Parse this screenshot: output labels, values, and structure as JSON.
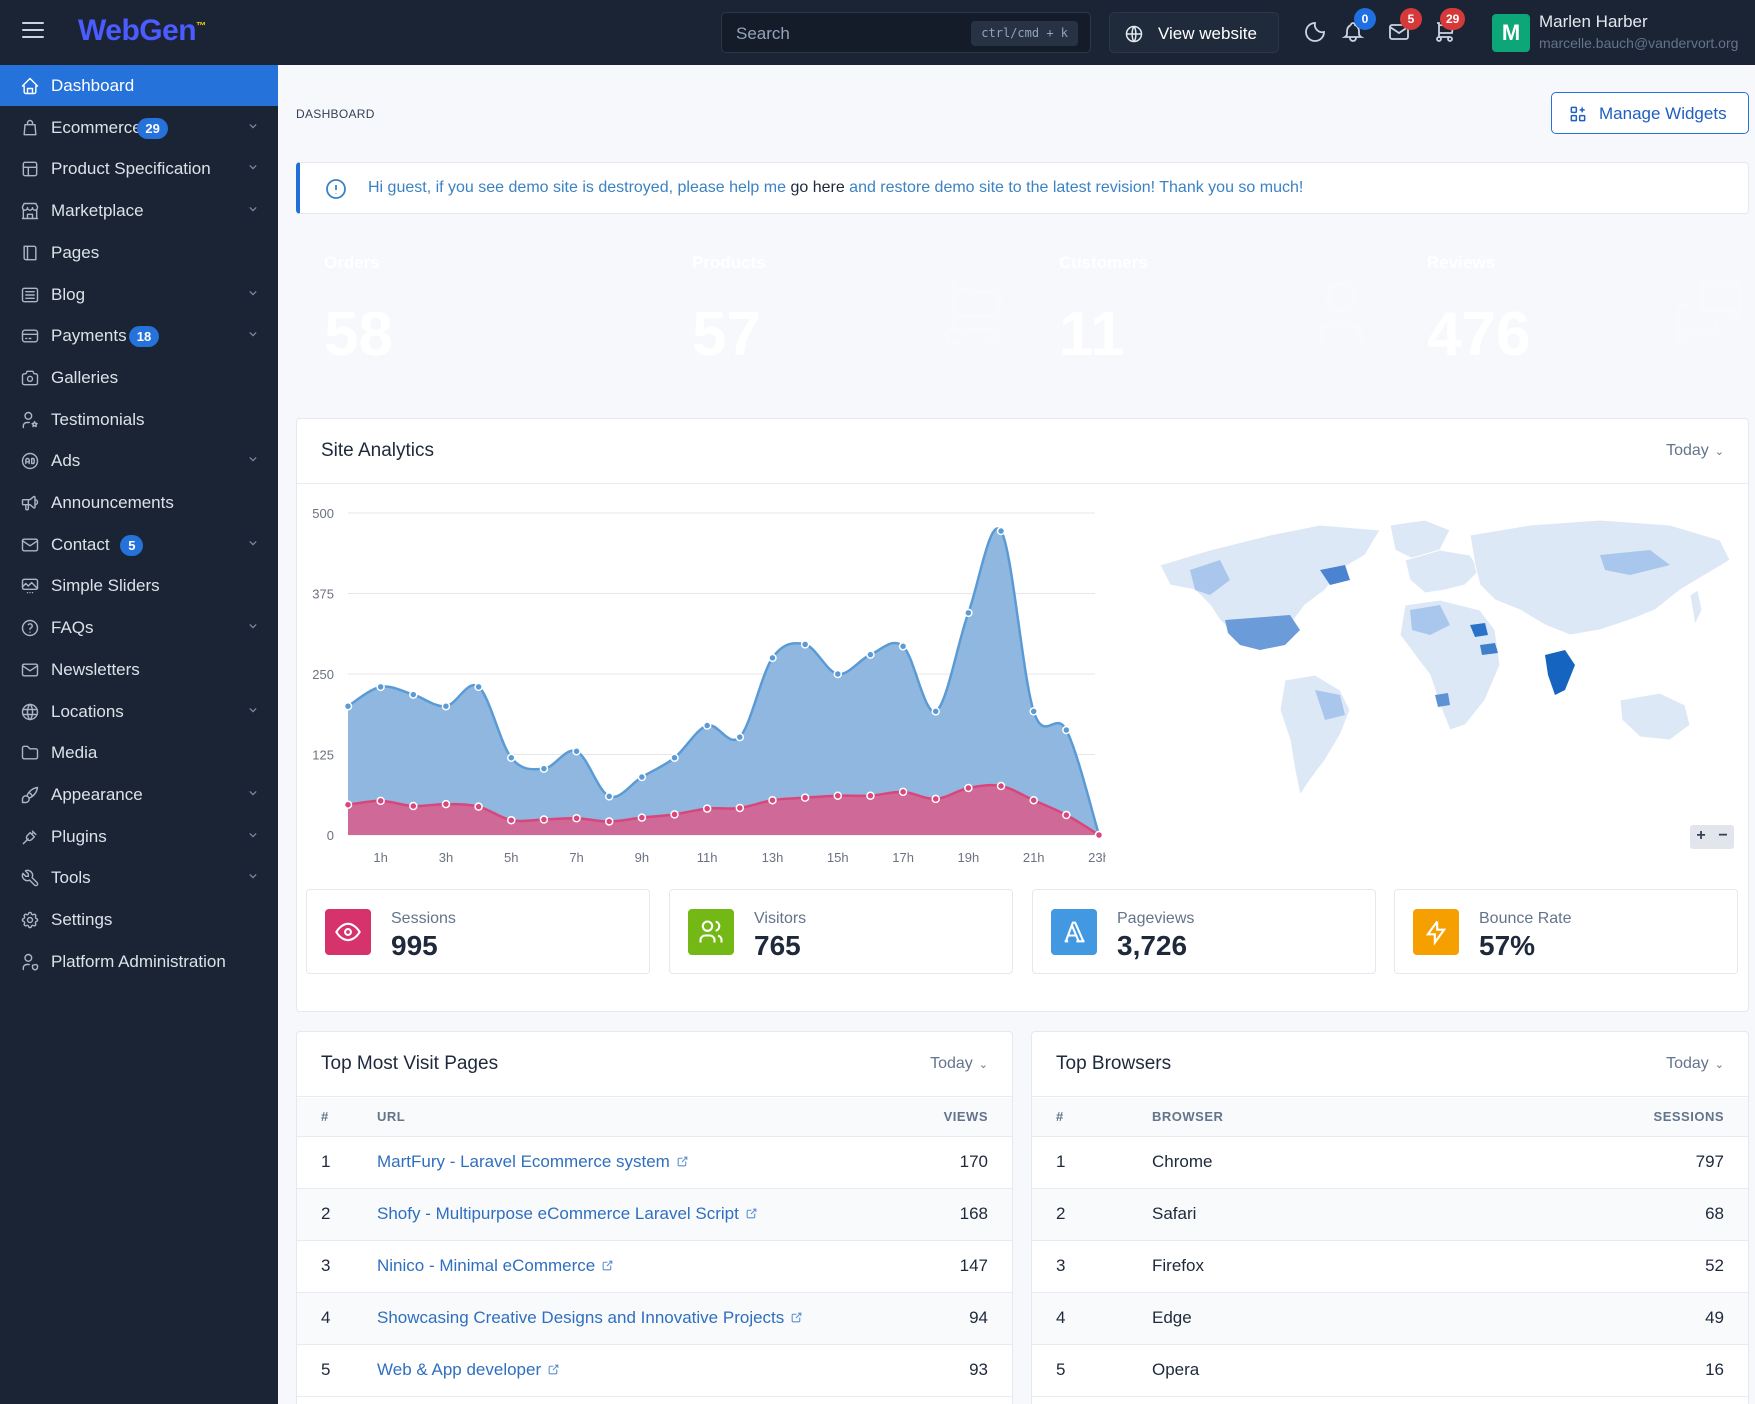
{
  "app": {
    "logo_main": "WebGen",
    "logo_mark": "™"
  },
  "topbar": {
    "search_placeholder": "Search",
    "search_shortcut": "ctrl/cmd + k",
    "view_website": "View website",
    "notifications_count": "0",
    "messages_count": "5",
    "orders_count": "29",
    "user": {
      "initial": "M",
      "name": "Marlen Harber",
      "email": "marcelle.bauch@vandervort.org"
    }
  },
  "sidebar": {
    "items": [
      {
        "label": "Dashboard",
        "icon": "home-icon",
        "active": true
      },
      {
        "label": "Ecommerce",
        "icon": "bag-icon",
        "badge": "29",
        "chevron": true
      },
      {
        "label": "Product Specification",
        "icon": "layout-icon",
        "chevron": true
      },
      {
        "label": "Marketplace",
        "icon": "store-icon",
        "chevron": true
      },
      {
        "label": "Pages",
        "icon": "book-icon"
      },
      {
        "label": "Blog",
        "icon": "article-icon",
        "chevron": true
      },
      {
        "label": "Payments",
        "icon": "credit-card-icon",
        "badge": "18",
        "chevron": true
      },
      {
        "label": "Galleries",
        "icon": "camera-icon"
      },
      {
        "label": "Testimonials",
        "icon": "user-star-icon"
      },
      {
        "label": "Ads",
        "icon": "ad-icon",
        "chevron": true
      },
      {
        "label": "Announcements",
        "icon": "speakerphone-icon"
      },
      {
        "label": "Contact",
        "icon": "mail-icon",
        "badge": "5",
        "chevron": true
      },
      {
        "label": "Simple Sliders",
        "icon": "slideshow-icon"
      },
      {
        "label": "FAQs",
        "icon": "help-circle-icon",
        "chevron": true
      },
      {
        "label": "Newsletters",
        "icon": "mail-icon"
      },
      {
        "label": "Locations",
        "icon": "globe-icon",
        "chevron": true
      },
      {
        "label": "Media",
        "icon": "folder-icon"
      },
      {
        "label": "Appearance",
        "icon": "brush-icon",
        "chevron": true
      },
      {
        "label": "Plugins",
        "icon": "plug-icon",
        "chevron": true
      },
      {
        "label": "Tools",
        "icon": "tool-icon",
        "chevron": true
      },
      {
        "label": "Settings",
        "icon": "gear-icon"
      },
      {
        "label": "Platform Administration",
        "icon": "user-shield-icon"
      }
    ]
  },
  "page": {
    "breadcrumb": "DASHBOARD",
    "manage_widgets": "Manage Widgets",
    "alert": {
      "before": "Hi guest, if you see demo site is destroyed, please help me ",
      "link": "go here",
      "after": " and restore demo site to the latest revision! Thank you so much!"
    }
  },
  "stats": [
    {
      "label": "Orders",
      "value": "58",
      "color": "#2ec4d6",
      "icon": "chart-icon"
    },
    {
      "label": "Products",
      "value": "57",
      "color": "#1a7ef0",
      "icon": "cart-icon"
    },
    {
      "label": "Customers",
      "value": "11",
      "color": "#6fb0f0",
      "icon": "user-icon"
    },
    {
      "label": "Reviews",
      "value": "476",
      "color": "#0a4aa0",
      "icon": "messages-icon"
    }
  ],
  "analytics": {
    "title": "Site Analytics",
    "filter": "Today",
    "zoom_in": "+",
    "zoom_out": "−",
    "chart_data": {
      "type": "area",
      "x": [
        "0h",
        "1h",
        "2h",
        "3h",
        "4h",
        "5h",
        "6h",
        "7h",
        "8h",
        "9h",
        "10h",
        "11h",
        "12h",
        "13h",
        "14h",
        "15h",
        "16h",
        "17h",
        "18h",
        "19h",
        "20h",
        "21h",
        "22h",
        "23h"
      ],
      "x_tick_labels": [
        "1h",
        "3h",
        "5h",
        "7h",
        "9h",
        "11h",
        "13h",
        "15h",
        "17h",
        "19h",
        "21h",
        "23h"
      ],
      "y_ticks": [
        0,
        125,
        250,
        375,
        500
      ],
      "ylim": [
        0,
        500
      ],
      "series": [
        {
          "color": "#5b9bd5",
          "values": [
            200,
            230,
            218,
            200,
            230,
            120,
            103,
            130,
            60,
            90,
            120,
            170,
            152,
            275,
            296,
            250,
            280,
            293,
            192,
            345,
            472,
            192,
            163,
            0
          ]
        },
        {
          "color": "#d9467a",
          "values": [
            47,
            53,
            45,
            48,
            44,
            23,
            24,
            26,
            21,
            27,
            32,
            41,
            42,
            54,
            58,
            61,
            61,
            67,
            56,
            73,
            76,
            54,
            31,
            0
          ]
        }
      ]
    },
    "metrics": [
      {
        "label": "Sessions",
        "value": "995",
        "color": "#d6336c",
        "icon": "eye-icon"
      },
      {
        "label": "Visitors",
        "value": "765",
        "color": "#74b816",
        "icon": "users-icon"
      },
      {
        "label": "Pageviews",
        "value": "3,726",
        "color": "#4299e1",
        "icon": "typography-icon"
      },
      {
        "label": "Bounce Rate",
        "value": "57%",
        "color": "#f59f00",
        "icon": "bolt-icon"
      }
    ]
  },
  "top_pages": {
    "title": "Top Most Visit Pages",
    "filter": "Today",
    "columns": [
      "#",
      "URL",
      "VIEWS"
    ],
    "rows": [
      {
        "n": "1",
        "url": "MartFury - Laravel Ecommerce system",
        "views": "170"
      },
      {
        "n": "2",
        "url": "Shofy - Multipurpose eCommerce Laravel Script",
        "views": "168"
      },
      {
        "n": "3",
        "url": "Ninico - Minimal eCommerce",
        "views": "147"
      },
      {
        "n": "4",
        "url": "Showcasing Creative Designs and Innovative Projects",
        "views": "94"
      },
      {
        "n": "5",
        "url": "Web & App developer",
        "views": "93"
      }
    ]
  },
  "top_browsers": {
    "title": "Top Browsers",
    "filter": "Today",
    "columns": [
      "#",
      "BROWSER",
      "SESSIONS"
    ],
    "rows": [
      {
        "n": "1",
        "browser": "Chrome",
        "sessions": "797"
      },
      {
        "n": "2",
        "browser": "Safari",
        "sessions": "68"
      },
      {
        "n": "3",
        "browser": "Firefox",
        "sessions": "52"
      },
      {
        "n": "4",
        "browser": "Edge",
        "sessions": "49"
      },
      {
        "n": "5",
        "browser": "Opera",
        "sessions": "16"
      }
    ]
  }
}
